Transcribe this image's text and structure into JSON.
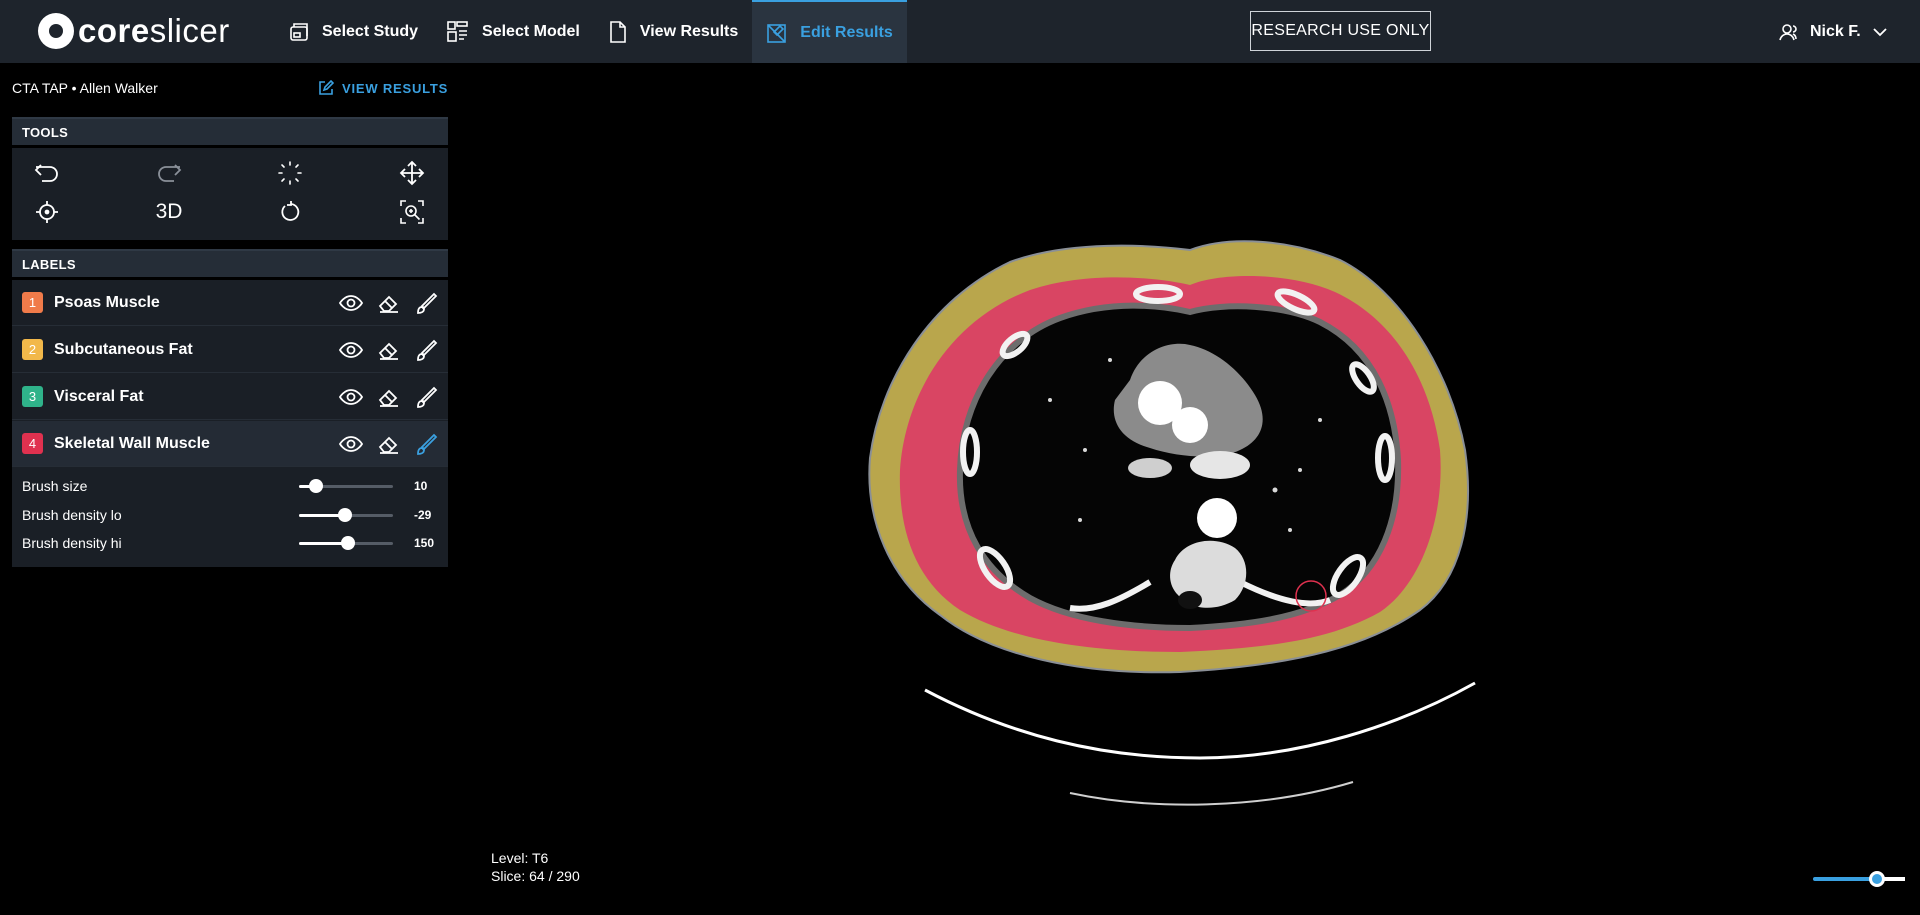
{
  "brand": {
    "bold": "core",
    "light": "slicer"
  },
  "nav": [
    {
      "label": "Select Study",
      "icon": "study-icon"
    },
    {
      "label": "Select Model",
      "icon": "model-icon"
    },
    {
      "label": "View Results",
      "icon": "document-icon"
    },
    {
      "label": "Edit Results",
      "icon": "edit-results-icon",
      "active": true
    }
  ],
  "research_badge": "RESEARCH USE ONLY",
  "user": {
    "name": "Nick F."
  },
  "study": {
    "title": "CTA TAP • Allen Walker",
    "view_results_link": "VIEW RESULTS"
  },
  "tools": {
    "header": "TOOLS",
    "items": [
      "undo",
      "redo",
      "threshold",
      "pan",
      "crosshair",
      "3D",
      "rotate",
      "zoom-region"
    ],
    "label_3d": "3D"
  },
  "labels": {
    "header": "LABELS",
    "items": [
      {
        "num": "1",
        "name": "Psoas Muscle",
        "color": "#f07b4a"
      },
      {
        "num": "2",
        "name": "Subcutaneous Fat",
        "color": "#f2b84a"
      },
      {
        "num": "3",
        "name": "Visceral Fat",
        "color": "#2fb38a"
      },
      {
        "num": "4",
        "name": "Skeletal Wall Muscle",
        "color": "#e0314f",
        "selected": true
      }
    ]
  },
  "brush": {
    "size": {
      "label": "Brush size",
      "value": "10",
      "fraction": 0.18
    },
    "density_lo": {
      "label": "Brush density lo",
      "value": "-29",
      "fraction": 0.49
    },
    "density_hi": {
      "label": "Brush density hi",
      "value": "150",
      "fraction": 0.52
    }
  },
  "viewer": {
    "level": "Level: T6",
    "slice": "Slice: 64 / 290",
    "zoom_fraction": 0.7
  },
  "colors": {
    "accent": "#3aa0e0",
    "fat_overlay": "#b9a64c",
    "muscle_overlay": "#d94563"
  }
}
